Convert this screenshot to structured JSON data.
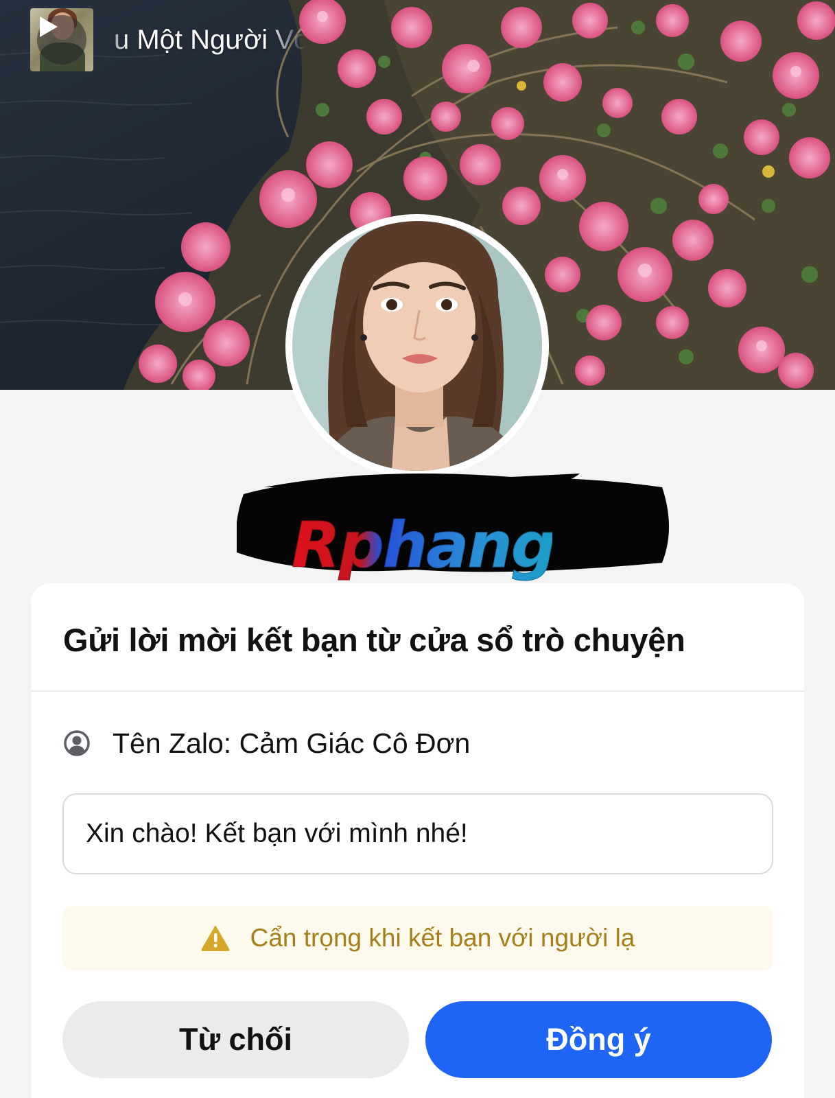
{
  "music": {
    "title": "u Một Người Vô",
    "thumbnail_icon": "music-cover-thumbnail",
    "play_icon": "play-icon"
  },
  "profile": {
    "name_redacted": true,
    "watermark": "Rphang"
  },
  "dialog": {
    "title": "Gửi lời mời kết bạn từ cửa sổ trò chuyện",
    "zalo_name": "Tên Zalo: Cảm Giác Cô Đơn",
    "zalo_icon": "user-circle-icon",
    "message": "Xin chào! Kết bạn với mình nhé!",
    "warning": "Cẩn trọng khi kết bạn với người lạ",
    "warning_icon": "warning-icon",
    "decline_label": "Từ chối",
    "accept_label": "Đồng ý"
  },
  "colors": {
    "accent": "#1e64f5",
    "warning_text": "#a5801a",
    "warning_bg": "#fdf9ec",
    "decline_bg": "#e9ebed"
  }
}
